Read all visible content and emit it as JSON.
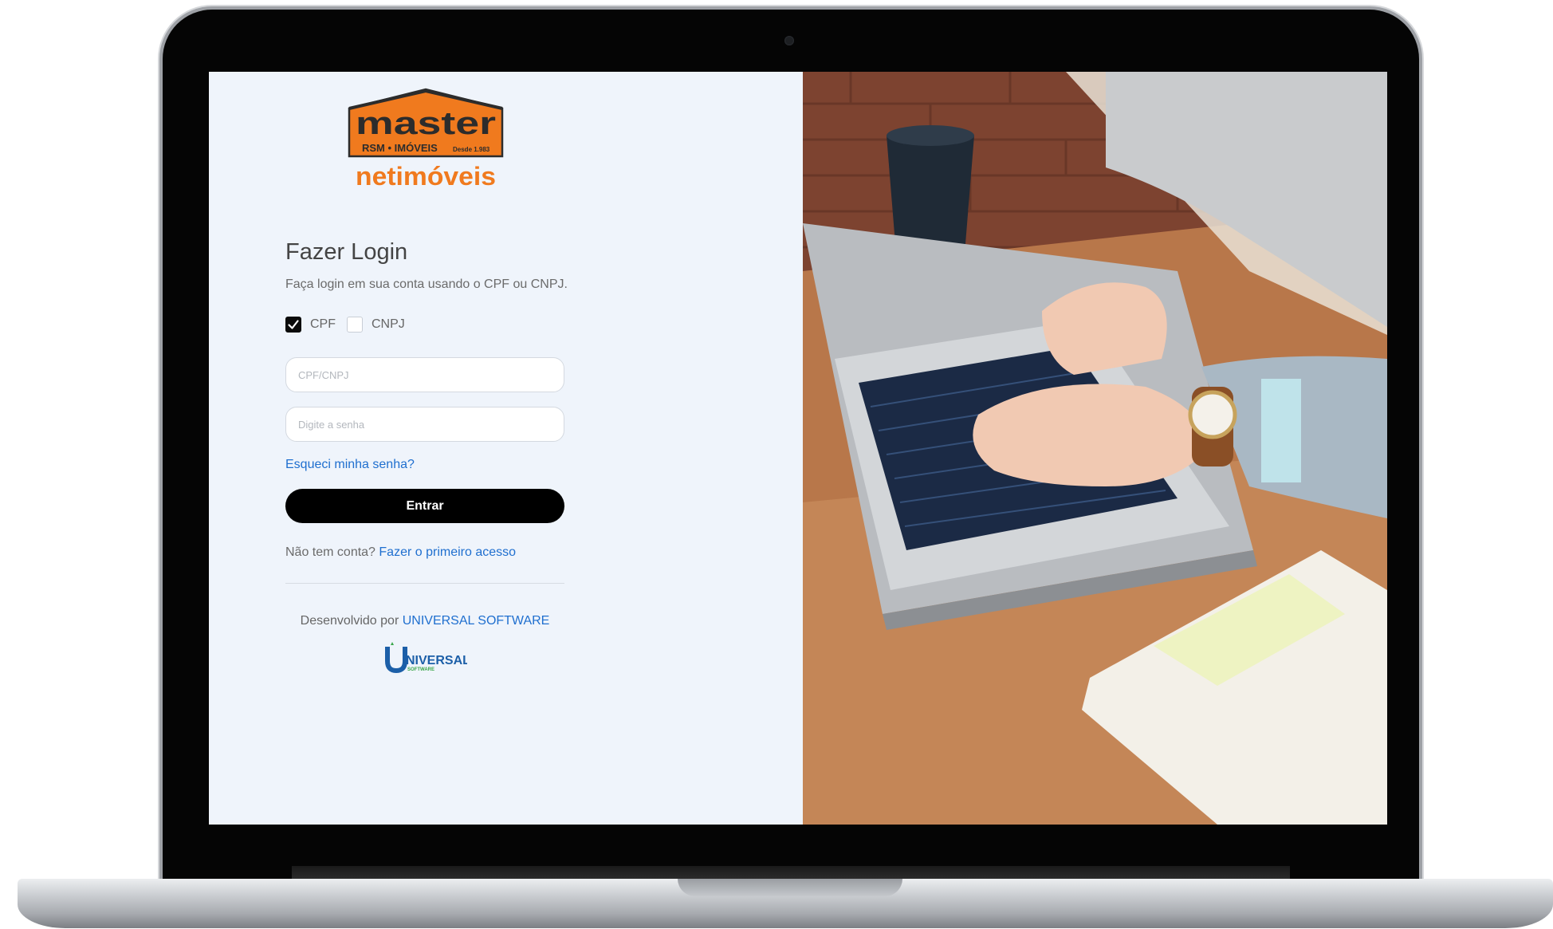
{
  "brand": {
    "logo_line1": "master",
    "logo_line2": "RSM • IMÓVEIS",
    "logo_since": "Desde 1.983",
    "logo_line3": "netimóveis",
    "orange": "#f07a1e",
    "dark": "#2c2c2c"
  },
  "login": {
    "title": "Fazer Login",
    "subtitle": "Faça login em sua conta usando o CPF ou CNPJ.",
    "doc_options": [
      {
        "label": "CPF",
        "checked": true
      },
      {
        "label": "CNPJ",
        "checked": false
      }
    ],
    "cpf_placeholder": "CPF/CNPJ",
    "password_placeholder": "Digite a senha",
    "forgot_label": "Esqueci minha senha?",
    "submit_label": "Entrar",
    "signup_prefix": "Não tem conta?",
    "signup_link": "Fazer o primeiro acesso"
  },
  "footer": {
    "credit_prefix": "Desenvolvido por",
    "credit_link": "UNIVERSAL SOFTWARE",
    "logo_word": "NIVERSAL",
    "logo_sub": "SOFTWARE"
  },
  "colors": {
    "link": "#1f6fcf",
    "button": "#000000",
    "panel_bg": "#eff4fb"
  },
  "icons": {
    "checkbox_checked": "check-icon"
  }
}
